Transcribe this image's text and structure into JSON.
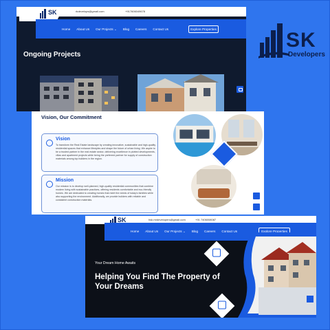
{
  "brand": {
    "name": "SK",
    "tagline": "Developers"
  },
  "panel1": {
    "topbar": {
      "email": "rkdevelops@gmail.com",
      "phone": "+917606049678"
    },
    "logo_text": "SK",
    "nav": {
      "links": [
        "Home",
        "About Us",
        "Our Projects ⌄",
        "Blog",
        "Careers",
        "Contact Us"
      ],
      "cta": "Explore Properties"
    },
    "heading": "Ongoing Projects"
  },
  "panel2": {
    "title": "Vision, Our Commitment",
    "vision": {
      "title": "Vision",
      "body": "To transform the Real Estate landscape by creating innovative, sustainable and high-quality residential spaces that enhance lifestyles and shape the future of urban living. We aspire to be a trusted partner in the real estate sector, delivering excellence in plotted developments, villas and apartment projects while being the preferred partner for supply of construction materials among top builders in the region."
    },
    "mission": {
      "title": "Mission",
      "body": "Our mission is to develop well-planned, high-quality residential communities that combine modern living with sustainable practices, offering residents comfortable and eco-friendly homes. We are dedicated to creating homes that meet the needs of today's families while also supporting the environment. Additionally, we provide builders with reliable and consistent construction materials."
    }
  },
  "panel3": {
    "topbar": {
      "email": "hsk.mrdevelopers@gmail.com",
      "phone": "+91 7406008087"
    },
    "logo_text": "SK",
    "nav": {
      "links": [
        "Home",
        "About Us",
        "Our Projects ⌄",
        "Blog",
        "Careers",
        "Contact Us"
      ],
      "cta": "Explore Properties"
    },
    "eyebrow": "Your Dream Home Awaits",
    "headline": "Helping You Find The Property of Your Dreams"
  },
  "colors": {
    "background": "#2f75ee",
    "accent": "#1a5be0",
    "dark": "#0f1a2e",
    "navy": "#0c1f4d"
  }
}
